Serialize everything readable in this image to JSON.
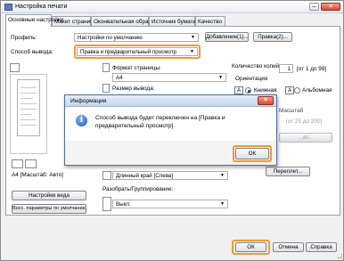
{
  "window": {
    "title": "Настройка печати",
    "buttons": {
      "minimize": "–",
      "maximize": "□",
      "close": "✕"
    }
  },
  "tabs": [
    {
      "label": "Основные настройки",
      "active": true
    },
    {
      "label": "Макет страницы"
    },
    {
      "label": "Оконвательная обработка"
    },
    {
      "label": "Источник бумаги"
    },
    {
      "label": "Качество"
    }
  ],
  "profile": {
    "label": "Профиль:",
    "value": "Настройки по умолчанию",
    "add_button": "Добавление(1)...",
    "edit_button": "Правка(2)..."
  },
  "output_method": {
    "label": "Способ вывода:",
    "value": "Правка и предварительный просмотр"
  },
  "page_format": {
    "label": "Формат страницы:",
    "value": "A4"
  },
  "output_size": {
    "label": "Размер вывода:"
  },
  "copies": {
    "label": "Количество копий:",
    "value": "1",
    "range": "[от 1 до 99]"
  },
  "orientation": {
    "label": "Ориентация",
    "portrait": "Книжная",
    "landscape": "Альбомная",
    "portrait_letter": "A",
    "landscape_letter": "A"
  },
  "scale": {
    "label": "Масштаб",
    "range": "[от 25 до 200]"
  },
  "watermark_button": "...ет...",
  "binding": {
    "value": "Длинный край [Слева]",
    "button": "Переплет..."
  },
  "collate": {
    "label": "Разобрать/Группирование:",
    "value": "Выкл."
  },
  "preview_caption": "A4 [Масштаб: Авто]",
  "view_settings_button": "Настройки вида",
  "restore_defaults_button": "Восс. параметры по умолчанию",
  "footer": {
    "ok": "ОК",
    "cancel": "Отмена",
    "help": "Справка"
  },
  "dialog": {
    "title": "Информация",
    "message": "Способ вывода будет переключен на [Правка и предварительный просмотр].",
    "ok": "ОК",
    "icon": "info-icon"
  },
  "colors": {
    "highlight": "#f29a2e",
    "dialog_title": "#c5d5ea"
  }
}
